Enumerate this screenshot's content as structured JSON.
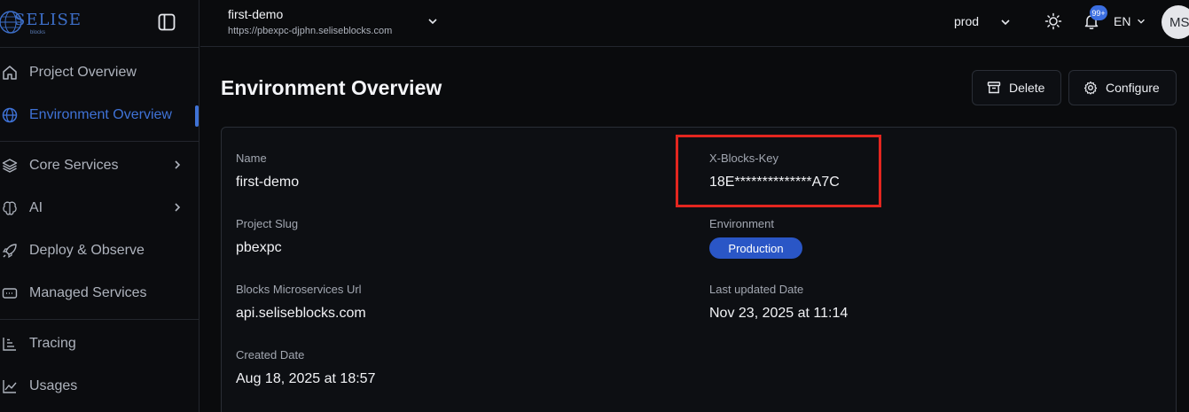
{
  "sidebar": {
    "logo_text": "SELISE",
    "logo_sub": "blocks",
    "items": [
      {
        "label": "Project Overview",
        "icon": "home-icon"
      },
      {
        "label": "Environment Overview",
        "icon": "globe-icon",
        "active": true
      },
      {
        "label": "Core Services",
        "icon": "layers-icon",
        "has_children": true
      },
      {
        "label": "AI",
        "icon": "brain-icon",
        "has_children": true
      },
      {
        "label": "Deploy & Observe",
        "icon": "rocket-icon"
      },
      {
        "label": "Managed Services",
        "icon": "server-icon"
      },
      {
        "label": "Tracing",
        "icon": "bar-chart-icon"
      },
      {
        "label": "Usages",
        "icon": "line-chart-icon"
      }
    ]
  },
  "header": {
    "project_name": "first-demo",
    "project_url": "https://pbexpc-djphn.seliseblocks.com",
    "environment": "prod",
    "notification_count": "99+",
    "language": "EN",
    "avatar_initials": "MS"
  },
  "main": {
    "title": "Environment Overview",
    "delete_label": "Delete",
    "configure_label": "Configure",
    "fields": {
      "name_label": "Name",
      "name_value": "first-demo",
      "slug_label": "Project Slug",
      "slug_value": "pbexpc",
      "url_label": "Blocks Microservices Url",
      "url_value": "api.seliseblocks.com",
      "created_label": "Created Date",
      "created_value": "Aug 18, 2025 at 18:57",
      "key_label": "X-Blocks-Key",
      "key_value": "18E**************A7C",
      "env_label": "Environment",
      "env_value": "Production",
      "updated_label": "Last updated Date",
      "updated_value": "Nov 23, 2025 at 11:14"
    }
  },
  "colors": {
    "accent": "#3f72d6",
    "badge": "#2a56c6",
    "highlight": "#e3261f",
    "background": "#0a0b0d"
  }
}
